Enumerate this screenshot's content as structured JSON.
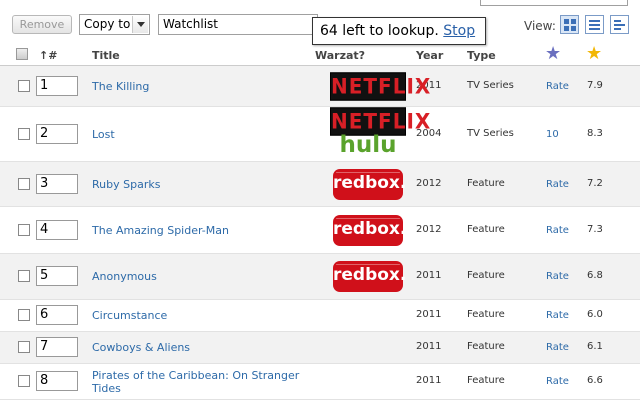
{
  "toolbar": {
    "remove_label": "Remove",
    "copy_select_value": "Copy to",
    "watchlist_value": "Watchlist",
    "view_label": "View:"
  },
  "tooltip": {
    "text": "64 left to lookup.",
    "stop_label": "Stop"
  },
  "header": {
    "sort_label": "↑#",
    "title": "Title",
    "warzat": "Warzat?",
    "year": "Year",
    "type": "Type"
  },
  "colors": {
    "link": "#2d6aa8",
    "user_star": "#6a6fbf",
    "imdb_star": "#f2b705",
    "netflix_red": "#d81f26",
    "hulu_green": "#5aa32c",
    "redbox_red": "#d0101a"
  },
  "rows": [
    {
      "num": "1",
      "title": "The Killing",
      "year": "2011",
      "type": "TV Series",
      "rate": "Rate",
      "score": "7.9",
      "logos": [
        "netflix"
      ]
    },
    {
      "num": "2",
      "title": "Lost",
      "year": "2004",
      "type": "TV Series",
      "rate": "10",
      "score": "8.3",
      "logos": [
        "netflix",
        "hulu"
      ]
    },
    {
      "num": "3",
      "title": "Ruby Sparks",
      "year": "2012",
      "type": "Feature",
      "rate": "Rate",
      "score": "7.2",
      "logos": [
        "redbox"
      ]
    },
    {
      "num": "4",
      "title": "The Amazing Spider-Man",
      "year": "2012",
      "type": "Feature",
      "rate": "Rate",
      "score": "7.3",
      "logos": [
        "redbox"
      ]
    },
    {
      "num": "5",
      "title": "Anonymous",
      "year": "2011",
      "type": "Feature",
      "rate": "Rate",
      "score": "6.8",
      "logos": [
        "redbox"
      ]
    },
    {
      "num": "6",
      "title": "Circumstance",
      "year": "2011",
      "type": "Feature",
      "rate": "Rate",
      "score": "6.0",
      "logos": []
    },
    {
      "num": "7",
      "title": "Cowboys & Aliens",
      "year": "2011",
      "type": "Feature",
      "rate": "Rate",
      "score": "6.1",
      "logos": []
    },
    {
      "num": "8",
      "title": "Pirates of the Caribbean: On Stranger Tides",
      "year": "2011",
      "type": "Feature",
      "rate": "Rate",
      "score": "6.6",
      "logos": []
    }
  ],
  "logo_text": {
    "netflix": "NETFLIX",
    "hulu": "hulu",
    "redbox": "redbox."
  }
}
